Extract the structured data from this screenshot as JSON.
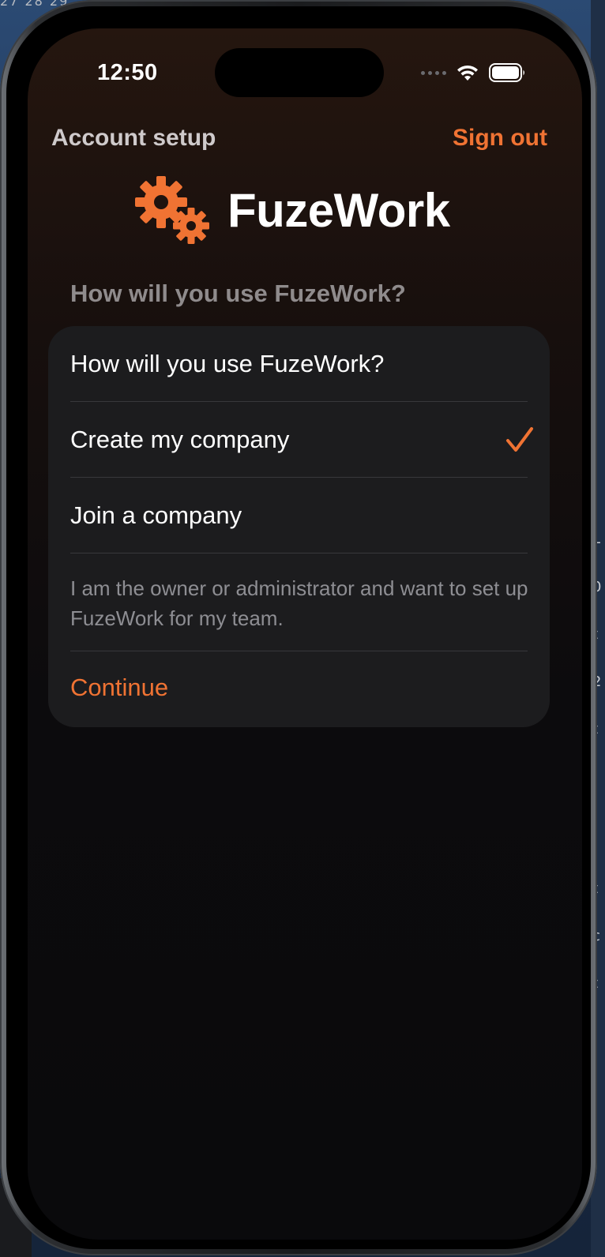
{
  "status_bar": {
    "time": "12:50",
    "icons": [
      "cellular-dots-icon",
      "wifi-icon",
      "battery-icon"
    ]
  },
  "nav": {
    "title": "Account setup",
    "sign_out": "Sign out"
  },
  "brand": {
    "name": "FuzeWork",
    "logo_icon": "gears-icon"
  },
  "section": {
    "header": "How will you use FuzeWork?"
  },
  "card": {
    "question": "How will you use FuzeWork?",
    "options": [
      {
        "label": "Create my company",
        "selected": true
      },
      {
        "label": "Join a company",
        "selected": false
      }
    ],
    "description": "I am the owner or administrator and want to set up FuzeWork for my team.",
    "continue_label": "Continue"
  },
  "background_fragments": {
    "top_numbers": "27  28  29",
    "edge_chars": [
      "L",
      "0",
      "t",
      "2",
      "t",
      "t",
      "c",
      "t"
    ]
  },
  "colors": {
    "accent": "#f07333",
    "card_bg": "#1c1c1e",
    "divider": "#38383b",
    "secondary_text": "#8e8e93"
  }
}
